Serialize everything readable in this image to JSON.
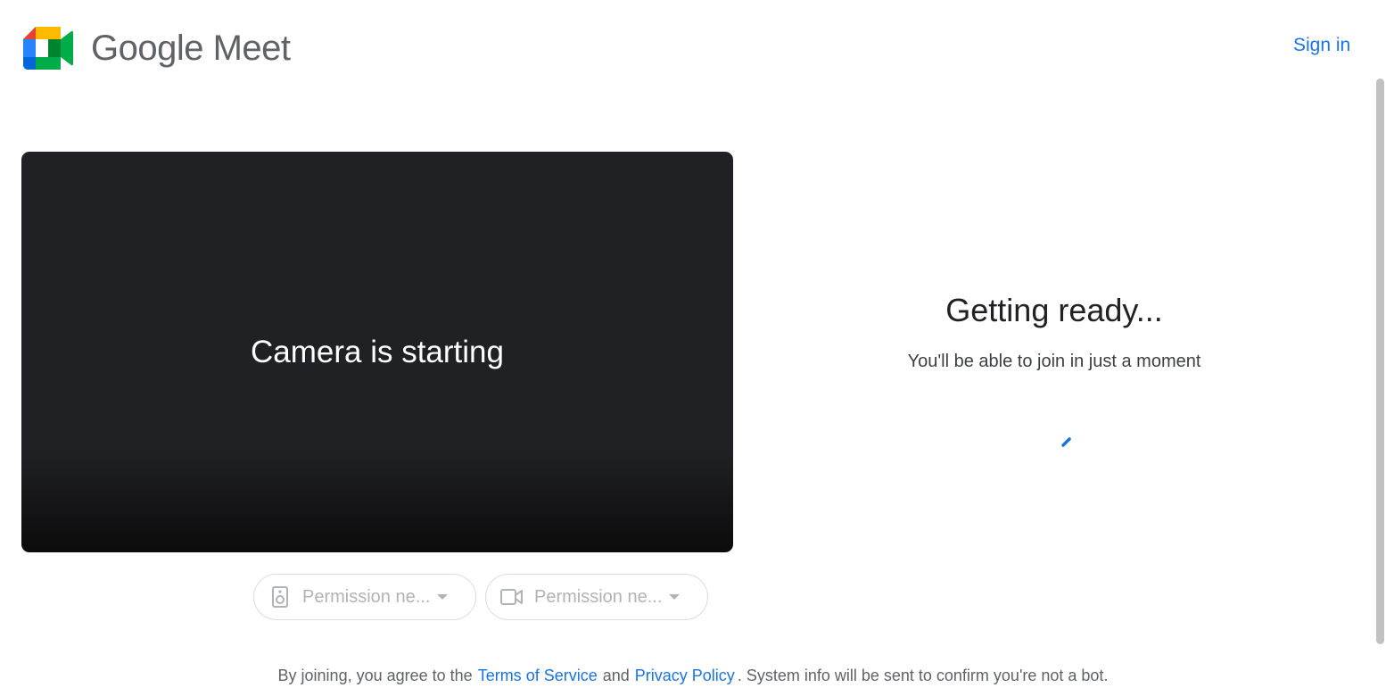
{
  "header": {
    "brand_name": "Google Meet",
    "sign_in_label": "Sign in"
  },
  "preview": {
    "status_text": "Camera is starting"
  },
  "devices": {
    "audio": {
      "label": "Permission ne...",
      "icon": "speaker-icon"
    },
    "video": {
      "label": "Permission ne...",
      "icon": "videocam-icon"
    }
  },
  "ready_panel": {
    "title": "Getting ready...",
    "subtitle": "You'll be able to join in just a moment"
  },
  "footer": {
    "prefix": "By joining, you agree to the",
    "terms_link": "Terms of Service",
    "and_text": "and",
    "privacy_link": "Privacy Policy",
    "suffix": ". System info will be sent to confirm you're not a bot."
  },
  "colors": {
    "accent": "#1a73e8",
    "video_background": "#202124",
    "muted_text": "#5f6368",
    "logo_green": "#00832d",
    "logo_blue": "#0066da",
    "logo_red": "#e94235",
    "logo_yellow": "#ffba00",
    "logo_light_green": "#00ac47",
    "logo_dark_blue": "#2684fc"
  }
}
